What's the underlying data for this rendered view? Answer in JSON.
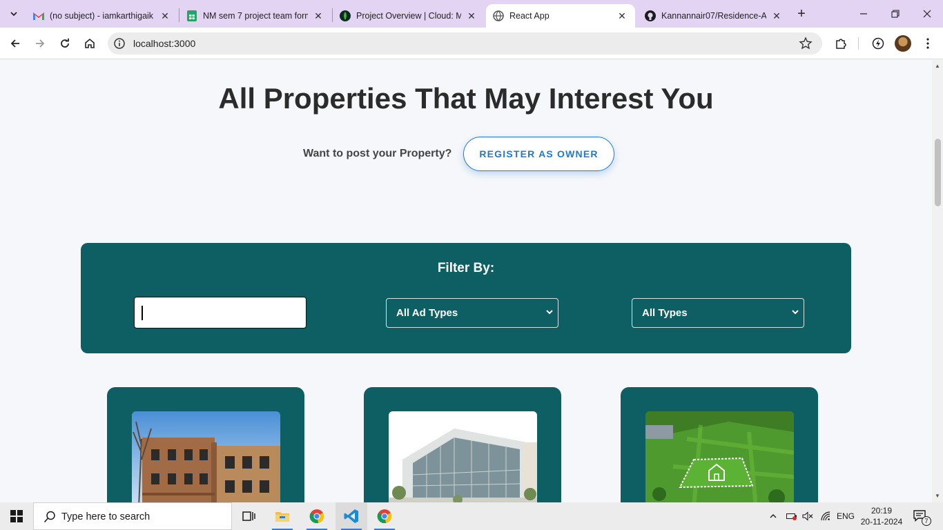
{
  "browser": {
    "tabs": [
      {
        "title": "(no subject) - iamkarthigaik",
        "icon": "gmail-icon",
        "active": false
      },
      {
        "title": "NM sem 7 project team form",
        "icon": "sheets-icon",
        "active": false
      },
      {
        "title": "Project Overview | Cloud: Mo",
        "icon": "mongodb-icon",
        "active": false
      },
      {
        "title": "React App",
        "icon": "globe-icon",
        "active": true
      },
      {
        "title": "Kannannair07/Residence-Au",
        "icon": "github-icon",
        "active": false
      }
    ],
    "address": "localhost:3000"
  },
  "page": {
    "heading": "All Properties That May Interest You",
    "owner_prompt": "Want to post your Property?",
    "owner_button": "REGISTER AS OWNER",
    "filter": {
      "title": "Filter By:",
      "search_value": "",
      "ad_type_selected": "All Ad Types",
      "type_selected": "All Types"
    },
    "cards": [
      {
        "image": "apartment-building-photo"
      },
      {
        "image": "glass-office-building-photo"
      },
      {
        "image": "green-land-plot-photo"
      }
    ],
    "colors": {
      "panel": "#0e5f63",
      "accent": "#1d79d3"
    }
  },
  "taskbar": {
    "search_placeholder": "Type here to search",
    "language": "ENG",
    "time": "20:19",
    "date": "20-11-2024",
    "notification_count": "7"
  }
}
